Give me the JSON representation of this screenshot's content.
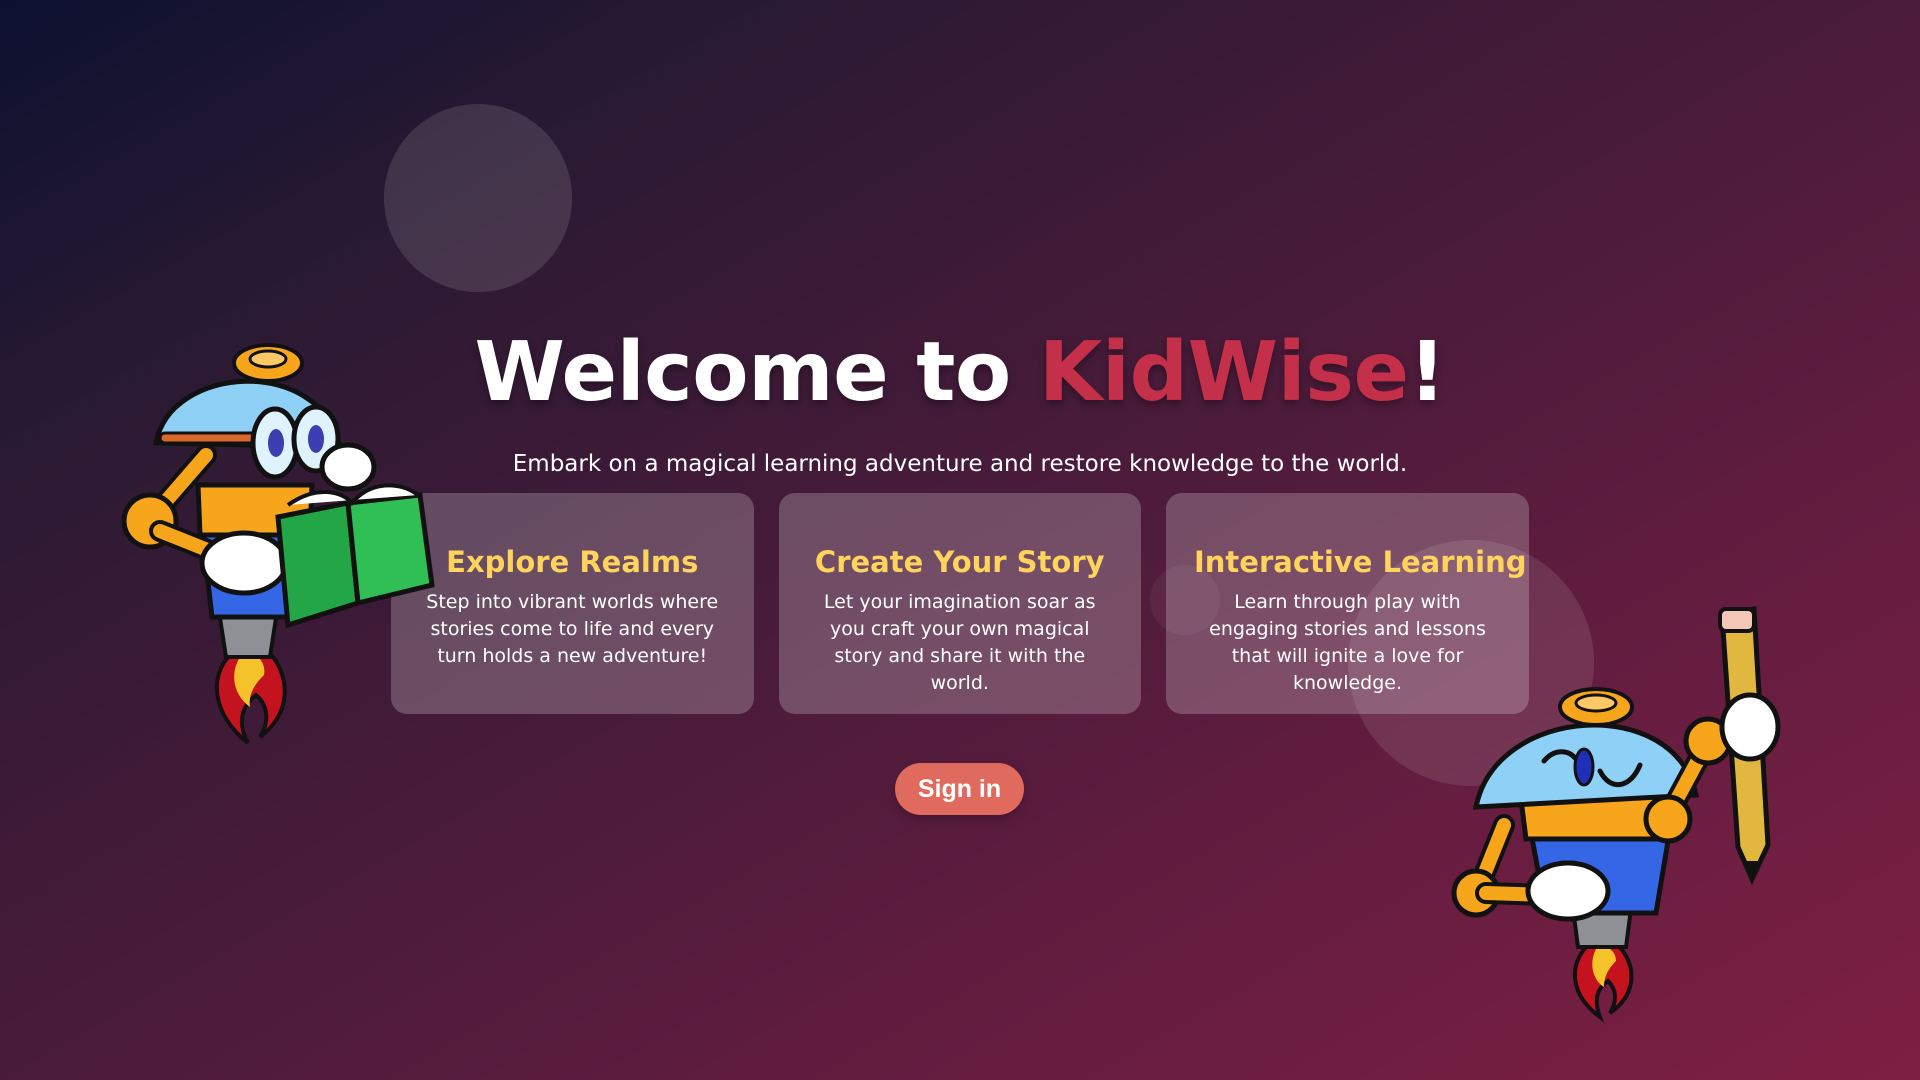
{
  "hero": {
    "title_prefix": "Welcome to ",
    "title_brand": "KidWise",
    "title_suffix": "!",
    "subtitle": "Embark on a magical learning adventure and restore knowledge to the world."
  },
  "features": [
    {
      "title": "Explore Realms",
      "body": "Step into vibrant worlds where stories come to life and every turn holds a new adventure!"
    },
    {
      "title": "Create Your Story",
      "body": "Let your imagination soar as you craft your own magical story and share it with the world."
    },
    {
      "title": "Interactive Learning",
      "body": "Learn through play with engaging stories and lessons that will ignite a love for knowledge."
    }
  ],
  "actions": {
    "signin_label": "Sign in"
  },
  "mascots": {
    "left_icon": "robot-reading-book-icon",
    "right_icon": "robot-holding-pencil-icon"
  },
  "colors": {
    "brand": "#c42f49",
    "card_title": "#ffd35c",
    "button": "#e06a5e"
  }
}
